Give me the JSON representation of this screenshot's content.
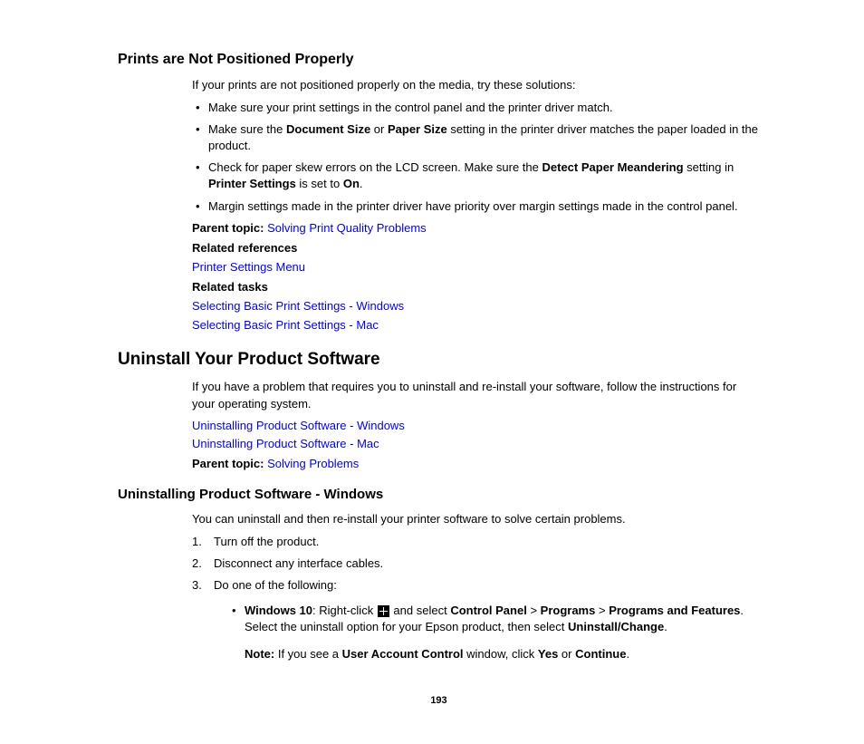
{
  "section1": {
    "heading": "Prints are Not Positioned Properly",
    "intro": "If your prints are not positioned properly on the media, try these solutions:",
    "bullets": {
      "b1": "Make sure your print settings in the control panel and the printer driver match.",
      "b2_pre": "Make sure the ",
      "b2_bold1": "Document Size",
      "b2_mid1": " or ",
      "b2_bold2": "Paper Size",
      "b2_post": " setting in the printer driver matches the paper loaded in the product.",
      "b3_pre": "Check for paper skew errors on the LCD screen. Make sure the ",
      "b3_bold1": "Detect Paper Meandering",
      "b3_mid1": " setting in ",
      "b3_bold2": "Printer Settings",
      "b3_mid2": " is set to ",
      "b3_bold3": "On",
      "b3_post": ".",
      "b4": "Margin settings made in the printer driver have priority over margin settings made in the control panel."
    },
    "parent_label": "Parent topic:",
    "parent_link": "Solving Print Quality Problems",
    "related_refs_label": "Related references",
    "related_refs_link": "Printer Settings Menu",
    "related_tasks_label": "Related tasks",
    "related_tasks_link1": "Selecting Basic Print Settings - Windows",
    "related_tasks_link2": "Selecting Basic Print Settings - Mac"
  },
  "section2": {
    "heading": "Uninstall Your Product Software",
    "intro": "If you have a problem that requires you to uninstall and re-install your software, follow the instructions for your operating system.",
    "link1": "Uninstalling Product Software - Windows",
    "link2": "Uninstalling Product Software - Mac",
    "parent_label": "Parent topic:",
    "parent_link": "Solving Problems"
  },
  "section3": {
    "heading": "Uninstalling Product Software - Windows",
    "intro": "You can uninstall and then re-install your printer software to solve certain problems.",
    "steps": {
      "s1": "Turn off the product.",
      "s2": "Disconnect any interface cables.",
      "s3": "Do one of the following:",
      "sub1_bold1": "Windows 10",
      "sub1_t1": ": Right-click ",
      "sub1_t2": " and select ",
      "sub1_bold2": "Control Panel",
      "sub1_t3": " > ",
      "sub1_bold3": "Programs",
      "sub1_t4": " > ",
      "sub1_bold4": "Programs and Features",
      "sub1_t5": ". Select the uninstall option for your Epson product, then select ",
      "sub1_bold5": "Uninstall/Change",
      "sub1_t6": ".",
      "note_bold": "Note:",
      "note_t1": " If you see a ",
      "note_bold2": "User Account Control",
      "note_t2": " window, click ",
      "note_bold3": "Yes",
      "note_t3": " or ",
      "note_bold4": "Continue",
      "note_t4": "."
    }
  },
  "page_number": "193"
}
